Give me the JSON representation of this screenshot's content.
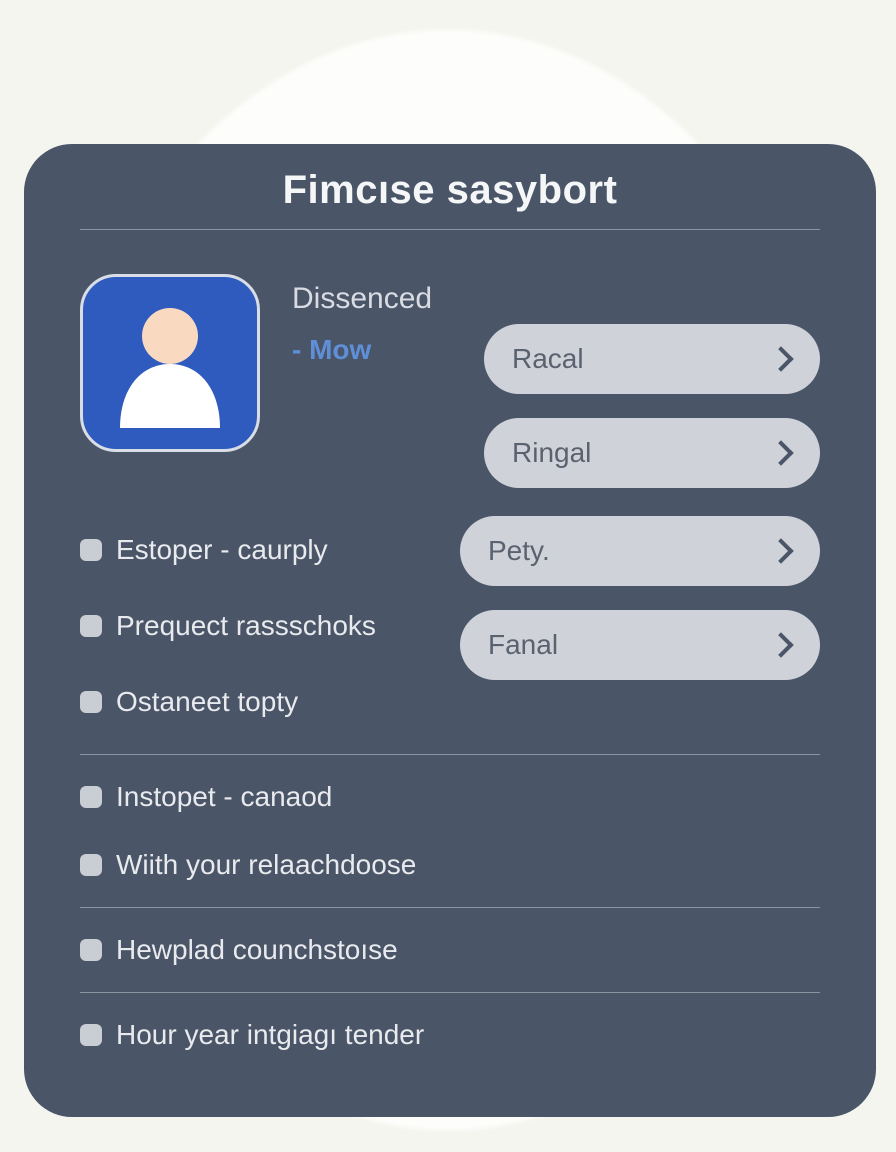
{
  "title": "Fimcıse sasybort",
  "profile": {
    "name": "Dissenced",
    "subtitle": "- Mow"
  },
  "buttons": [
    {
      "label": "Racal"
    },
    {
      "label": "Ringal"
    },
    {
      "label": "Pety."
    },
    {
      "label": "Fanal"
    }
  ],
  "groupA": [
    {
      "label": "Estoper - caurply"
    },
    {
      "label": "Prequect rassschoks"
    },
    {
      "label": "Ostaneet topty"
    }
  ],
  "groupB": [
    {
      "label": "Instopet - canaod"
    },
    {
      "label": "Wiith your relaachdoose"
    }
  ],
  "groupC": [
    {
      "label": "Hewplad counchstoıse"
    }
  ],
  "groupD": [
    {
      "label": "Hour year intgiagı tender"
    }
  ]
}
